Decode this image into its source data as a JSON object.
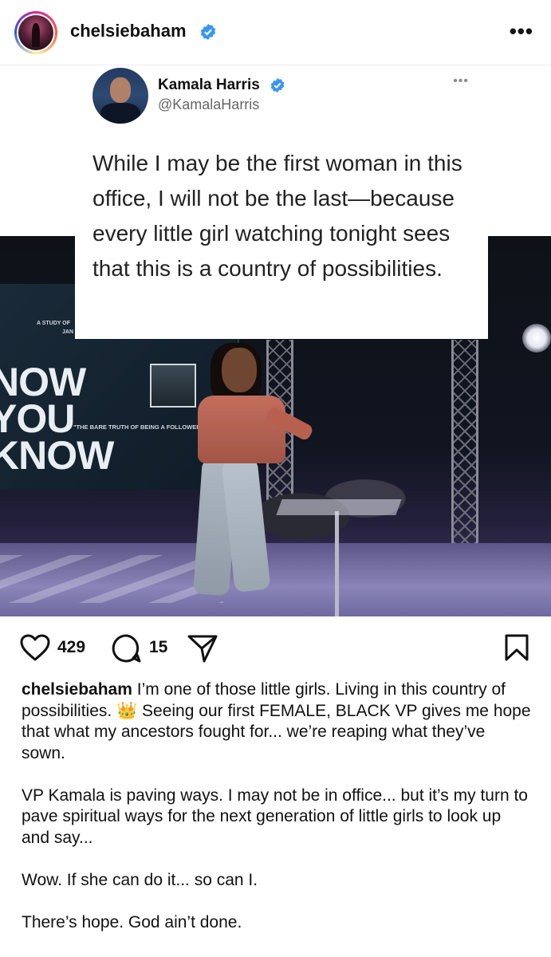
{
  "header": {
    "username": "chelsiebaham",
    "verified_icon": "verified-badge-icon",
    "more_icon": "more-horizontal-icon",
    "more_label": "•••"
  },
  "tweet": {
    "name": "Kamala Harris",
    "handle": "@KamalaHarris",
    "more_label": "•••",
    "text": "While I may be the first woman in this office, I will not be the last—because every little girl watching tonight sees that this is a country of possibilities."
  },
  "photo": {
    "screen_line1": "NOW",
    "screen_line2": "YOU",
    "screen_line3": "KNOW",
    "screen_small_top": "A STUDY OF",
    "screen_small_top2": "JAN",
    "screen_quote": "\"THE BARE TRUTH OF BEING A FOLLOWER\""
  },
  "actions": {
    "likes": "429",
    "comments": "15",
    "icons": [
      "heart-icon",
      "comment-icon",
      "share-icon",
      "bookmark-icon"
    ]
  },
  "caption": {
    "username": "chelsiebaham",
    "para1_text": " I’m one of those little girls. Living in this country of possibilities. 👑 Seeing our first FEMALE, BLACK VP gives me hope that what my ancestors fought for... we’re reaping what they’ve sown.",
    "para2": "VP Kamala is paving ways. I may not be in office... but it’s my turn to pave  spiritual ways for the next generation of little girls to look up and say...",
    "para3": "Wow. If she can do it... so can I.",
    "para4": "There’s hope. God ain’t done."
  },
  "colors": {
    "verified_blue": "#3897f0",
    "text": "#111111",
    "secondary": "#666666"
  }
}
